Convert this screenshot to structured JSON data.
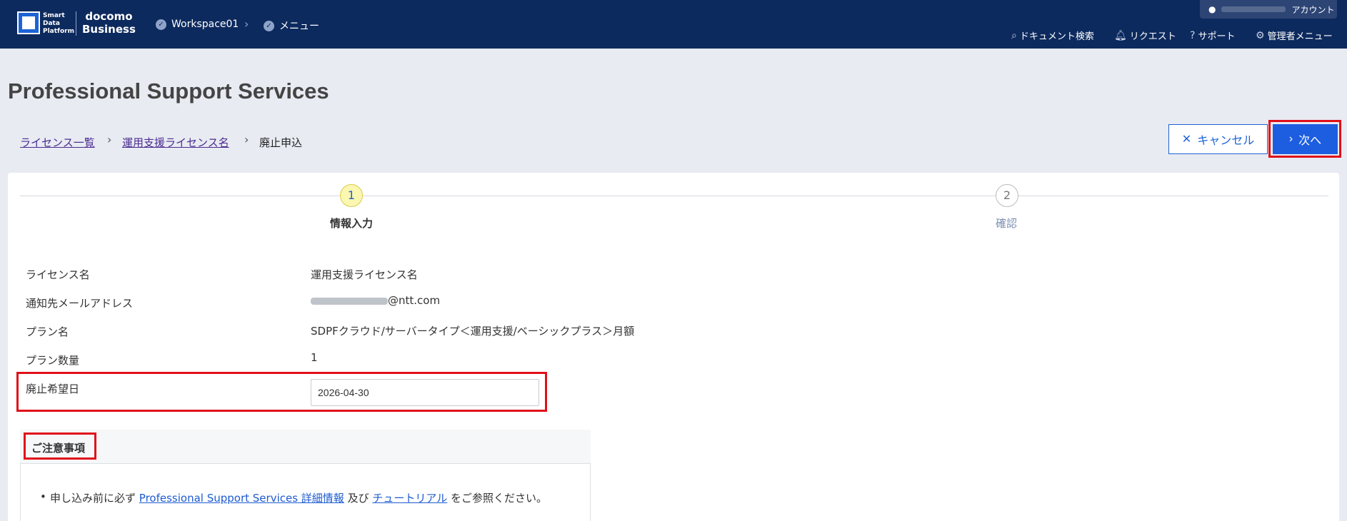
{
  "header": {
    "logo_lines": [
      "Smart",
      "Data",
      "Platform"
    ],
    "brand_top": "docomo",
    "brand_bottom": "Business",
    "workspace": "Workspace01",
    "menu": "メニュー",
    "account_label": "アカウント",
    "nav": {
      "doc_search": "ドキュメント検索",
      "request": "リクエスト",
      "support": "サポート",
      "admin_menu": "管理者メニュー"
    }
  },
  "page": {
    "title": "Professional Support Services"
  },
  "breadcrumb": {
    "item1": "ライセンス一覧",
    "item2": "運用支援ライセンス名",
    "current": "廃止申込"
  },
  "actions": {
    "cancel": "キャンセル",
    "next": "次へ"
  },
  "steps": [
    {
      "number": "1",
      "label": "情報入力",
      "active": true
    },
    {
      "number": "2",
      "label": "確認",
      "active": false
    }
  ],
  "form": {
    "license_name_label": "ライセンス名",
    "license_name_value": "運用支援ライセンス名",
    "email_label": "通知先メールアドレス",
    "email_domain": "@ntt.com",
    "plan_label": "プラン名",
    "plan_value": "SDPFクラウド/サーバータイプ＜運用支援/ベーシックプラス＞月額",
    "qty_label": "プラン数量",
    "qty_value": "1",
    "date_label": "廃止希望日",
    "date_value": "2026-04-30"
  },
  "notice": {
    "title": "ご注意事項",
    "prefix": "申し込み前に必ず",
    "link1": "Professional Support Services 詳細情報",
    "mid": "及び",
    "link2": "チュートリアル",
    "suffix": "をご参照ください。"
  },
  "colors": {
    "header_bg": "#0d2a5e",
    "primary": "#1d5ee0",
    "highlight": "#e0101a",
    "step_active_bg": "#fbf6b0"
  }
}
